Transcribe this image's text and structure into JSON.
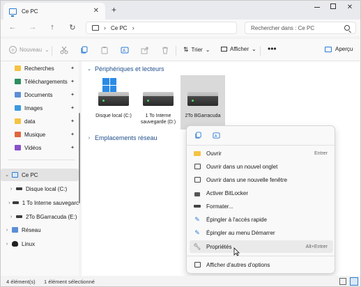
{
  "titlebar": {
    "tab_label": "Ce PC",
    "tab_close": "✕",
    "new_tab": "+",
    "minimize": "",
    "maximize": "",
    "close": "✕"
  },
  "navbar": {
    "back": "←",
    "forward": "→",
    "up": "↑",
    "refresh": "↻",
    "address_sep1": "›",
    "address_label": "Ce PC",
    "address_sep2": "›",
    "search_placeholder": "Rechercher dans : Ce PC"
  },
  "commandbar": {
    "new_label": "Nouveau",
    "new_chevron": "⌄",
    "sort_label": "Trier",
    "sort_chevron": "⌄",
    "view_label": "Afficher",
    "view_chevron": "⌄",
    "more": "•••",
    "preview_label": "Aperçu"
  },
  "sidebar": {
    "quick_access": [
      {
        "label": "Recherches",
        "pin": "📌"
      },
      {
        "label": "Téléchargements",
        "pin": "📌"
      },
      {
        "label": "Documents",
        "pin": "📌"
      },
      {
        "label": "Images",
        "pin": "📌"
      },
      {
        "label": "data",
        "pin": "📌"
      },
      {
        "label": "Musique",
        "pin": "📌"
      },
      {
        "label": "Vidéos",
        "pin": "📌"
      }
    ],
    "this_pc": "Ce PC",
    "drives": [
      {
        "label": "Disque local (C:)"
      },
      {
        "label": "1 To Interne sauvegarc"
      },
      {
        "label": "2To BGarracuda (E:)"
      }
    ],
    "network": "Réseau",
    "linux": "Linux"
  },
  "main": {
    "group_devices": "Périphériques et lecteurs",
    "group_network": "Emplacements réseau",
    "drives": [
      {
        "label": "Disque local (C:)"
      },
      {
        "label": "1 To Interne sauvegarde (D:)"
      },
      {
        "label": "2To BGarracuda"
      }
    ]
  },
  "context_menu": {
    "items": [
      {
        "label": "Ouvrir",
        "shortcut": "Entrer",
        "icon": "folder-icon"
      },
      {
        "label": "Ouvrir dans un nouvel onglet",
        "shortcut": "",
        "icon": "new-tab-icon"
      },
      {
        "label": "Ouvrir dans une nouvelle fenêtre",
        "shortcut": "",
        "icon": "new-window-icon"
      },
      {
        "label": "Activer BitLocker",
        "shortcut": "",
        "icon": "bitlocker-icon"
      },
      {
        "label": "Formater...",
        "shortcut": "",
        "icon": "format-icon"
      },
      {
        "label": "Épingler à l'accès rapide",
        "shortcut": "",
        "icon": "pin-icon"
      },
      {
        "label": "Épingler au menu Démarrer",
        "shortcut": "",
        "icon": "pin-start-icon"
      },
      {
        "label": "Propriétés",
        "shortcut": "Alt+Entrer",
        "icon": "wrench-icon"
      },
      {
        "label": "Afficher d'autres d'options",
        "shortcut": "",
        "icon": "more-options-icon"
      }
    ]
  },
  "statusbar": {
    "count": "4 élément(s)",
    "selection": "1 élément sélectionné"
  },
  "colors": {
    "accent": "#2b7bd4",
    "group_header": "#1f4e8c"
  }
}
